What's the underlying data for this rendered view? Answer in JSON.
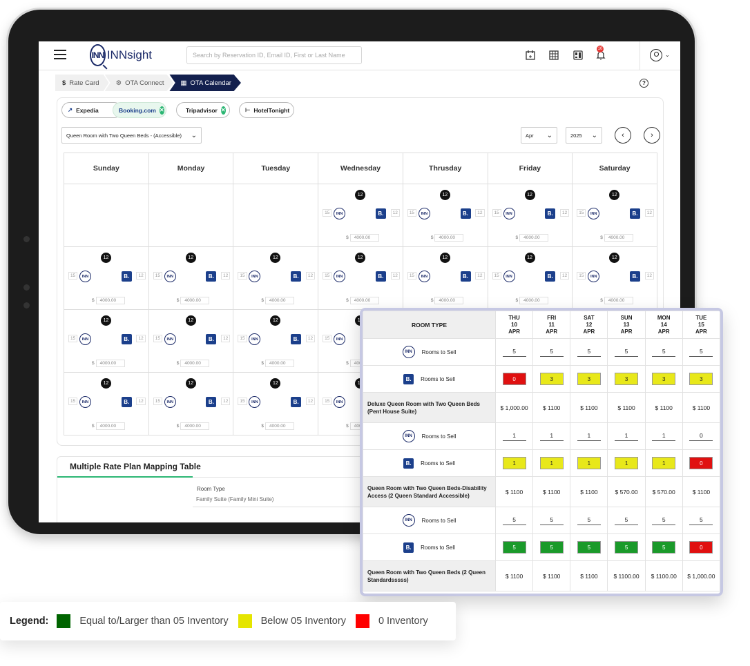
{
  "app": {
    "logo_text": "INNsight",
    "logo_mark": "INN",
    "search_placeholder": "Search by Reservation ID, Email ID, First or Last Name",
    "notification_count": "10"
  },
  "breadcrumbs": [
    {
      "label": "Rate Card",
      "icon": "$"
    },
    {
      "label": "OTA Connect",
      "icon": "ota-connect-icon"
    },
    {
      "label": "OTA Calendar",
      "icon": "calendar-icon"
    }
  ],
  "otas": [
    {
      "name": "Expedia",
      "connected": false
    },
    {
      "name": "Booking.com",
      "connected": true
    },
    {
      "name": "Tripadvisor",
      "connected": true
    },
    {
      "name": "HotelTonight",
      "connected": false
    }
  ],
  "room_select": "Queen Room with Two Queen Beds - (Accessible)",
  "month": "Apr",
  "year": "2025",
  "weekdays": [
    "Sunday",
    "Monday",
    "Tuesday",
    "Wednesday",
    "Thrusday",
    "Friday",
    "Saturday"
  ],
  "cell": {
    "badge": "12",
    "left_inv": "15",
    "right_inv": "12",
    "currency": "$",
    "price": "4000.00",
    "inn": "INN",
    "booking": "B."
  },
  "multi": {
    "title": "Multiple Rate Plan Mapping Table",
    "room_type_label": "Room Type",
    "room_type_value": "Family Suite (Family Mini Suite)"
  },
  "overlay": {
    "header": "ROOM TYPE",
    "days": [
      {
        "d": "THU",
        "n": "10",
        "m": "APR"
      },
      {
        "d": "FRI",
        "n": "11",
        "m": "APR"
      },
      {
        "d": "SAT",
        "n": "12",
        "m": "APR"
      },
      {
        "d": "SUN",
        "n": "13",
        "m": "APR"
      },
      {
        "d": "MON",
        "n": "14",
        "m": "APR"
      },
      {
        "d": "TUE",
        "n": "15",
        "m": "APR"
      }
    ],
    "rooms_label": "Rooms to Sell",
    "groups": [
      {
        "name": "Deluxe Queen Room with Two Queen Beds (Pent House Suite)",
        "inn": [
          "5",
          "5",
          "5",
          "5",
          "5",
          "5"
        ],
        "booking": [
          "0",
          "3",
          "3",
          "3",
          "3",
          "3"
        ],
        "booking_status": [
          "red",
          "yellow",
          "yellow",
          "yellow",
          "yellow",
          "yellow"
        ],
        "prices": [
          "$ 1,000.00",
          "$ 1100",
          "$ 1100",
          "$ 1100",
          "$ 1100",
          "$ 1100"
        ]
      },
      {
        "name": "Queen Room with Two Queen Beds-Disability Access (2 Queen Standard Accessible)",
        "inn": [
          "1",
          "1",
          "1",
          "1",
          "1",
          "0"
        ],
        "booking": [
          "1",
          "1",
          "1",
          "1",
          "1",
          "0"
        ],
        "booking_status": [
          "yellow",
          "yellow",
          "yellow",
          "yellow",
          "yellow",
          "red"
        ],
        "prices": [
          "$ 1100",
          "$ 1100",
          "$ 1100",
          "$ 570.00",
          "$ 570.00",
          "$ 1100"
        ]
      },
      {
        "name": "Queen Room with Two Queen Beds (2 Queen Standardsssss)",
        "inn": [
          "5",
          "5",
          "5",
          "5",
          "5",
          "5"
        ],
        "booking": [
          "5",
          "5",
          "5",
          "5",
          "5",
          "0"
        ],
        "booking_status": [
          "green",
          "green",
          "green",
          "green",
          "green",
          "red"
        ],
        "prices": [
          "$ 1100",
          "$ 1100",
          "$ 1100",
          "$ 1100.00",
          "$ 1100.00",
          "$ 1,000.00"
        ]
      }
    ]
  },
  "legend": {
    "title": "Legend:",
    "items": [
      {
        "label": "Equal to/Larger than 05 Inventory",
        "color": "#006400"
      },
      {
        "label": "Below 05 Inventory",
        "color": "#e5e500"
      },
      {
        "label": "0 Inventory",
        "color": "#ff0000"
      }
    ]
  },
  "status_colors": {
    "green": "#1a9a2a",
    "yellow": "#e8e81a",
    "red": "#e01010"
  }
}
